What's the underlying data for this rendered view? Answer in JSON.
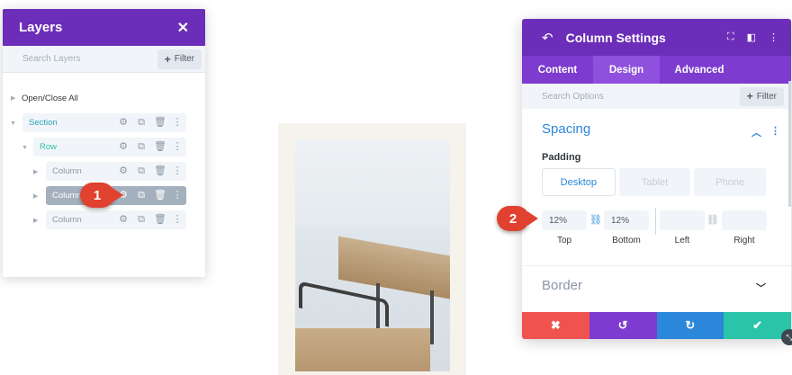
{
  "layers": {
    "title": "Layers",
    "close_glyph": "✕",
    "search_placeholder": "Search Layers",
    "filter_label": "Filter",
    "open_close_label": "Open/Close All",
    "items": [
      {
        "label": "Section",
        "color": "#2ea3b8"
      },
      {
        "label": "Row",
        "color": "#29c4a9"
      },
      {
        "label": "Column",
        "color": "#8b97a5"
      },
      {
        "label": "Column",
        "color": "#ffffff"
      },
      {
        "label": "Column",
        "color": "#8b97a5"
      }
    ]
  },
  "settings": {
    "title": "Column Settings",
    "tabs": [
      {
        "label": "Content"
      },
      {
        "label": "Design"
      },
      {
        "label": "Advanced"
      }
    ],
    "search_placeholder": "Search Options",
    "filter_label": "Filter",
    "spacing_title": "Spacing",
    "padding_label": "Padding",
    "devices": [
      "Desktop",
      "Tablet",
      "Phone"
    ],
    "padding": {
      "top": {
        "value": "12%",
        "label": "Top"
      },
      "bottom": {
        "value": "12%",
        "label": "Bottom"
      },
      "left": {
        "value": "",
        "label": "Left"
      },
      "right": {
        "value": "",
        "label": "Right"
      }
    },
    "border_title": "Border",
    "actions": [
      {
        "glyph": "✖",
        "color": "#ef5350"
      },
      {
        "glyph": "↺",
        "color": "#7e3bd0"
      },
      {
        "glyph": "↻",
        "color": "#2b87da"
      },
      {
        "glyph": "✔",
        "color": "#29c4a9"
      }
    ]
  },
  "callouts": [
    {
      "number": "1"
    },
    {
      "number": "2"
    }
  ],
  "colors": {
    "purple_header": "#6c2eb9",
    "purple_tabs": "#7d3bcf",
    "accent_blue": "#2b87da",
    "callout_red": "#e0422f"
  }
}
